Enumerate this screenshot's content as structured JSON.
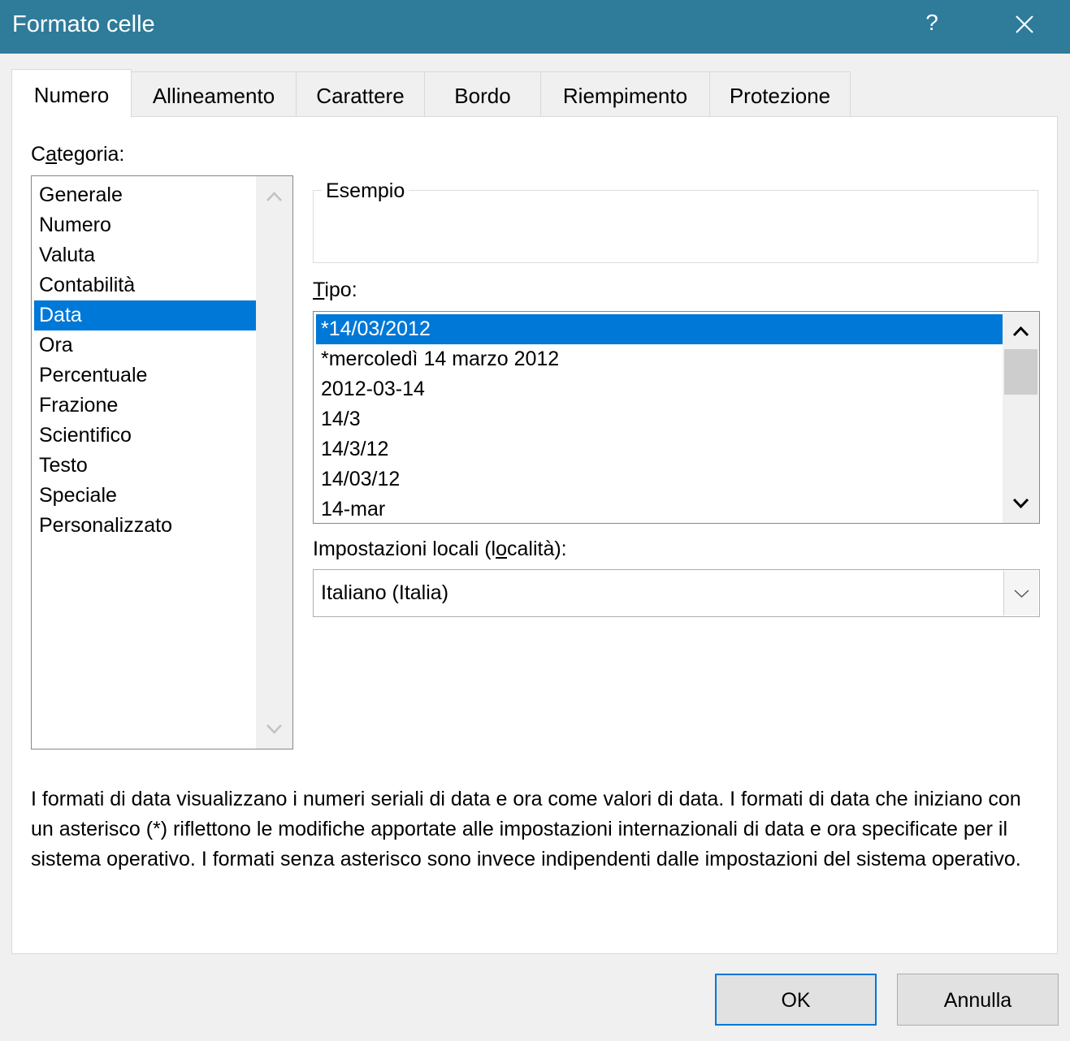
{
  "window": {
    "title": "Formato celle",
    "help_label": "?"
  },
  "tabs": [
    {
      "label": "Numero",
      "active": true
    },
    {
      "label": "Allineamento"
    },
    {
      "label": "Carattere"
    },
    {
      "label": "Bordo"
    },
    {
      "label": "Riempimento"
    },
    {
      "label": "Protezione"
    }
  ],
  "category": {
    "label_pre": "C",
    "label_accel": "a",
    "label_post": "tegoria:",
    "items": [
      "Generale",
      "Numero",
      "Valuta",
      "Contabilità",
      "Data",
      "Ora",
      "Percentuale",
      "Frazione",
      "Scientifico",
      "Testo",
      "Speciale",
      "Personalizzato"
    ],
    "selected": "Data"
  },
  "sample": {
    "legend": "Esempio",
    "value": ""
  },
  "type": {
    "label_accel": "T",
    "label_post": "ipo:",
    "items": [
      "*14/03/2012",
      "*mercoledì 14 marzo 2012",
      "2012-03-14",
      "14/3",
      "14/3/12",
      "14/03/12",
      "14-mar"
    ],
    "selected": "*14/03/2012"
  },
  "locale": {
    "label_pre": "Impostazioni locali (l",
    "label_accel": "o",
    "label_post": "calità):",
    "value": "Italiano (Italia)"
  },
  "description": "I formati di data visualizzano i numeri seriali di data e ora come valori di data. I formati di data che iniziano con un asterisco (*) riflettono le modifiche apportate alle impostazioni internazionali di data e ora specificate per il sistema operativo. I formati senza asterisco sono invece indipendenti dalle impostazioni del sistema operativo.",
  "buttons": {
    "ok": "OK",
    "cancel": "Annulla"
  },
  "colors": {
    "titlebar": "#2e7b9a",
    "selection": "#0078d7"
  }
}
